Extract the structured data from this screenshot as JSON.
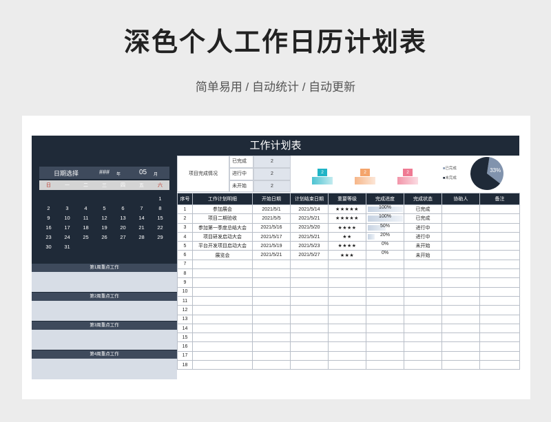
{
  "title": "深色个人工作日历计划表",
  "subtitle": "简单易用 / 自动统计 / 自动更新",
  "sheet_title": "工作计划表",
  "calendar": {
    "label": "日期选择",
    "year_value": "###",
    "year_unit": "年",
    "month_value": "05",
    "month_unit": "月",
    "weekdays": [
      "日",
      "一",
      "二",
      "三",
      "四",
      "五",
      "六"
    ],
    "rows": [
      [
        "",
        "",
        "",
        "",
        "",
        "",
        "1"
      ],
      [
        "2",
        "3",
        "4",
        "5",
        "6",
        "7",
        "8"
      ],
      [
        "9",
        "10",
        "11",
        "12",
        "13",
        "14",
        "15"
      ],
      [
        "16",
        "17",
        "18",
        "19",
        "20",
        "21",
        "22"
      ],
      [
        "23",
        "24",
        "25",
        "26",
        "27",
        "28",
        "29"
      ],
      [
        "30",
        "31",
        "",
        "",
        "",
        "",
        ""
      ]
    ]
  },
  "weeks": [
    "第1周重点工作",
    "第2周重点工作",
    "第3周重点工作",
    "第4周重点工作"
  ],
  "summary": {
    "label": "项目完成情况",
    "rows": [
      {
        "status": "已完成",
        "count": "2"
      },
      {
        "status": "进行中",
        "count": "2"
      },
      {
        "status": "未开始",
        "count": "2"
      }
    ],
    "tiles": [
      {
        "value": "2",
        "color": "#1fb4c6"
      },
      {
        "value": "2",
        "color": "#f4a46b"
      },
      {
        "value": "2",
        "color": "#ef7a93"
      }
    ],
    "pie": {
      "label": "33%",
      "legend": [
        "已完成",
        "未完成"
      ],
      "colors": [
        "#8193ad",
        "#1f2a38"
      ],
      "done_fraction": 0.33
    }
  },
  "table": {
    "headers": [
      "序号",
      "工作计划明细",
      "开始日期",
      "计划结束日期",
      "重要等级",
      "完成进度",
      "完成状态",
      "协助人",
      "备注"
    ],
    "rows": [
      {
        "no": "1",
        "task": "参加展会",
        "start": "2021/5/1",
        "end": "2021/5/14",
        "stars": "★★★★★",
        "progress": "100%",
        "pct": 1.0,
        "status": "已完成"
      },
      {
        "no": "2",
        "task": "项目二期验收",
        "start": "2021/5/5",
        "end": "2021/5/21",
        "stars": "★★★★★",
        "progress": "100%",
        "pct": 1.0,
        "status": "已完成"
      },
      {
        "no": "3",
        "task": "参加第一季度总结大会",
        "start": "2021/5/16",
        "end": "2021/5/20",
        "stars": "★★★★",
        "progress": "50%",
        "pct": 0.5,
        "status": "进行中"
      },
      {
        "no": "4",
        "task": "项目研发启动大会",
        "start": "2021/5/17",
        "end": "2021/5/21",
        "stars": "★★",
        "progress": "20%",
        "pct": 0.2,
        "status": "进行中"
      },
      {
        "no": "5",
        "task": "平台开发项目启动大会",
        "start": "2021/5/19",
        "end": "2021/5/23",
        "stars": "★★★★",
        "progress": "0%",
        "pct": 0,
        "status": "未开始"
      },
      {
        "no": "6",
        "task": "展览会",
        "start": "2021/5/21",
        "end": "2021/5/27",
        "stars": "★★★",
        "progress": "0%",
        "pct": 0,
        "status": "未开始"
      },
      {
        "no": "7"
      },
      {
        "no": "8"
      },
      {
        "no": "9"
      },
      {
        "no": "10"
      },
      {
        "no": "11"
      },
      {
        "no": "12"
      },
      {
        "no": "13"
      },
      {
        "no": "14"
      },
      {
        "no": "15"
      },
      {
        "no": "16"
      },
      {
        "no": "17"
      },
      {
        "no": "18"
      }
    ]
  }
}
